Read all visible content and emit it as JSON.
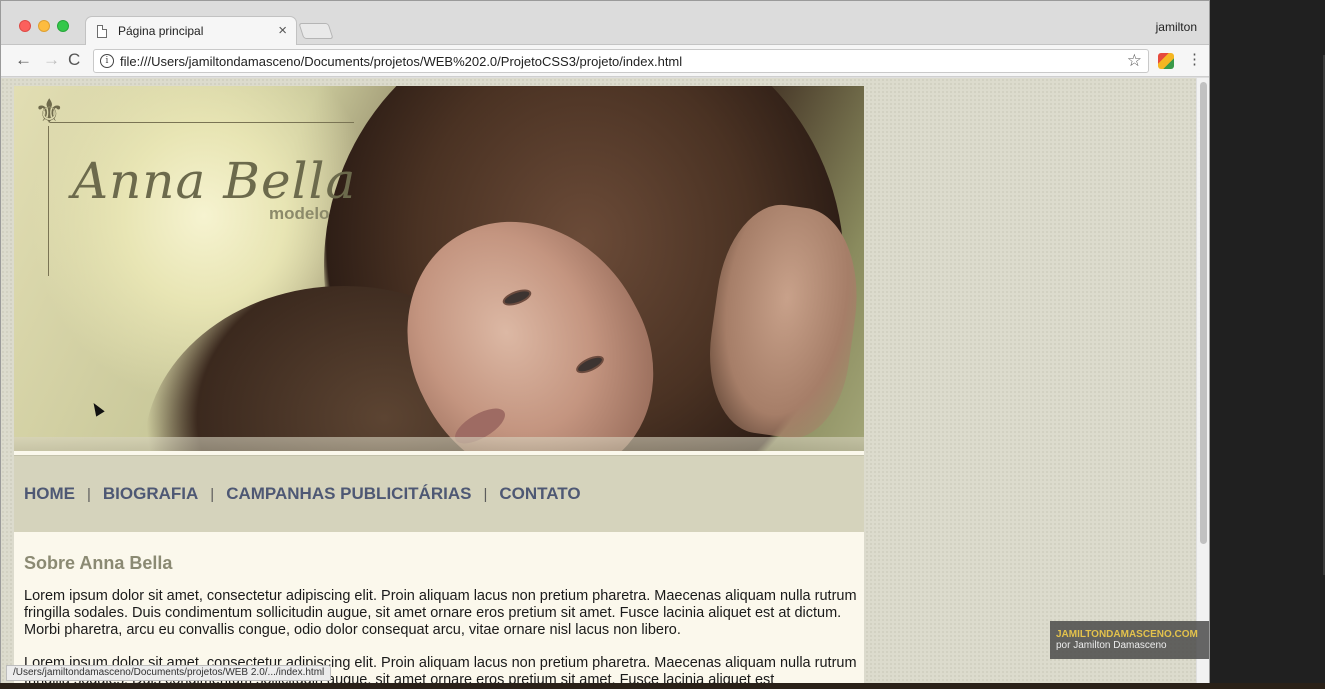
{
  "browser": {
    "tab_title": "Página principal",
    "tab_close": "×",
    "profile_name": "jamilton",
    "url": "file:///Users/jamiltondamasceno/Documents/projetos/WEB%202.0/ProjetoCSS3/projeto/index.html",
    "status_url": "/Users/jamiltondamasceno/Documents/projetos/WEB 2.0/.../index.html",
    "icons": {
      "back": "←",
      "forward": "→",
      "reload": "C",
      "info": "i",
      "star": "☆",
      "menu": "⋮"
    }
  },
  "site": {
    "logo_name": "Anna Bella",
    "logo_sub": "modelo",
    "fleur": "⚜",
    "nav": [
      {
        "label": "HOME"
      },
      {
        "label": "BIOGRAFIA"
      },
      {
        "label": "CAMPANHAS PUBLICITÁRIAS"
      },
      {
        "label": "CONTATO"
      }
    ],
    "separator": "|",
    "section_title": "Sobre Anna Bella",
    "paragraphs": [
      "Lorem ipsum dolor sit amet, consectetur adipiscing elit. Proin aliquam lacus non pretium pharetra. Maecenas aliquam nulla rutrum fringilla sodales. Duis condimentum sollicitudin augue, sit amet ornare eros pretium sit amet. Fusce lacinia aliquet est at dictum. Morbi pharetra, arcu eu convallis congue, odio dolor consequat arcu, vitae ornare nisl lacus non libero.",
      "Lorem ipsum dolor sit amet, consectetur adipiscing elit. Proin aliquam lacus non pretium pharetra. Maecenas aliquam nulla rutrum fringilla sodales. Duis condimentum sollicitudin augue, sit amet ornare eros pretium sit amet. Fusce lacinia aliquet est"
    ]
  },
  "watermark": {
    "line1": "JAMILTONDAMASCENO.COM",
    "line2": "por Jamilton Damasceno"
  },
  "colors": {
    "nav_link": "#4e5874",
    "nav_bar": "#d5d3bc",
    "section_title": "#8b8a73",
    "page_bg": "#fbf8ec"
  }
}
